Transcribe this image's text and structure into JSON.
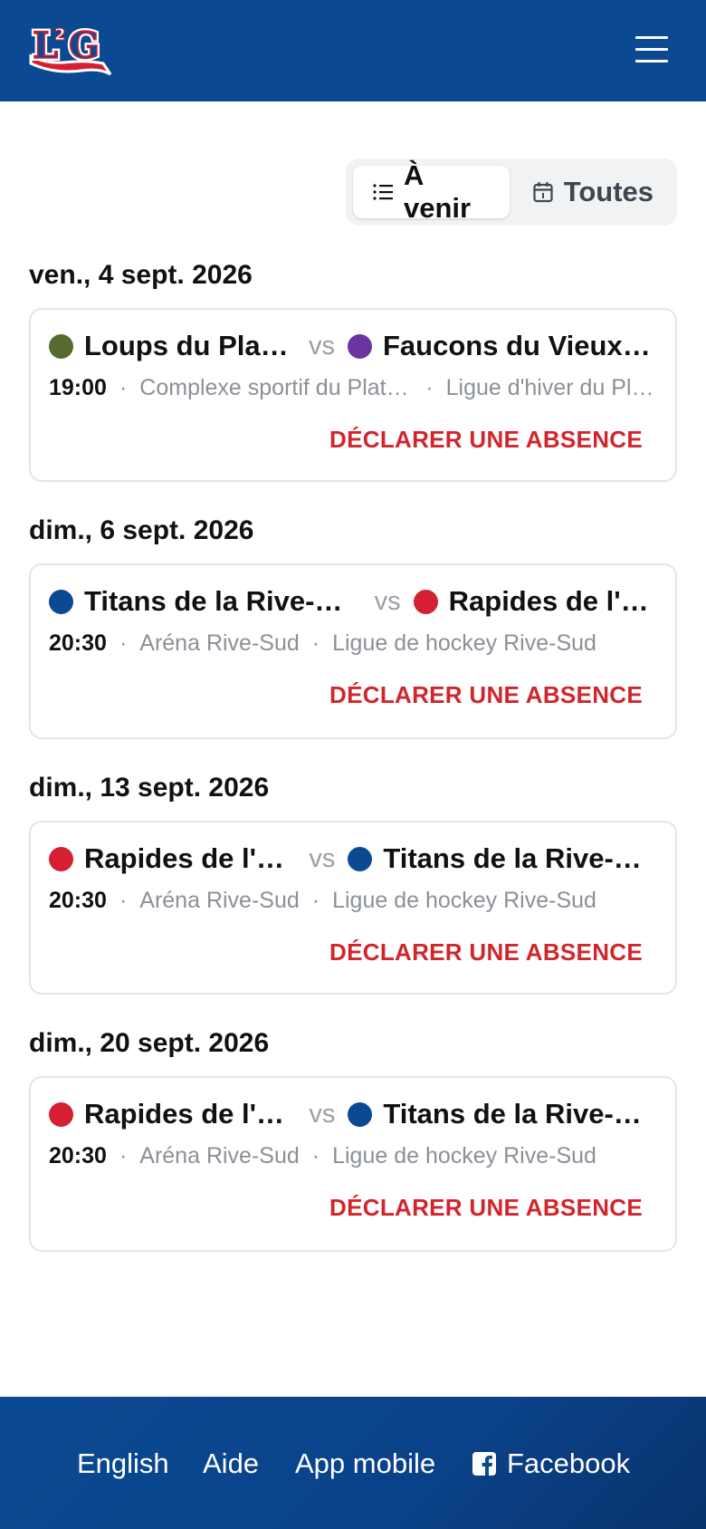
{
  "header": {
    "logo_text": "L2G"
  },
  "filter": {
    "upcoming_label": "À venir",
    "all_label": "Toutes",
    "active": "upcoming"
  },
  "separator": "·",
  "vs_label": "vs",
  "games": [
    {
      "date": "ven., 4 sept. 2026",
      "home": {
        "name": "Loups du Plateau",
        "color": "#556b2f"
      },
      "away": {
        "name": "Faucons du Vieux-Port",
        "color": "#6a35a0"
      },
      "time": "19:00",
      "venue": "Complexe sportif du Plateau",
      "league": "Ligue d'hiver du Plateau",
      "action": "DÉCLARER UNE ABSENCE"
    },
    {
      "date": "dim., 6 sept. 2026",
      "home": {
        "name": "Titans de la Rive-Sud",
        "color": "#0b4a93"
      },
      "away": {
        "name": "Rapides de l'Est",
        "color": "#d71f33"
      },
      "time": "20:30",
      "venue": "Aréna Rive-Sud",
      "league": "Ligue de hockey Rive-Sud",
      "action": "DÉCLARER UNE ABSENCE"
    },
    {
      "date": "dim., 13 sept. 2026",
      "home": {
        "name": "Rapides de l'Est",
        "color": "#d71f33"
      },
      "away": {
        "name": "Titans de la Rive-Sud",
        "color": "#0b4a93"
      },
      "time": "20:30",
      "venue": "Aréna Rive-Sud",
      "league": "Ligue de hockey Rive-Sud",
      "action": "DÉCLARER UNE ABSENCE"
    },
    {
      "date": "dim., 20 sept. 2026",
      "home": {
        "name": "Rapides de l'Est",
        "color": "#d71f33"
      },
      "away": {
        "name": "Titans de la Rive-Sud",
        "color": "#0b4a93"
      },
      "time": "20:30",
      "venue": "Aréna Rive-Sud",
      "league": "Ligue de hockey Rive-Sud",
      "action": "DÉCLARER UNE ABSENCE"
    }
  ],
  "footer": {
    "links": [
      "English",
      "Aide",
      "App mobile",
      "Facebook"
    ]
  },
  "colors": {
    "brand": "#0b4a93",
    "danger": "#d0262c",
    "muted": "#8b9098"
  },
  "icons": {
    "menu": "hamburger-icon",
    "upcoming": "list-icon",
    "all": "calendar-icon",
    "facebook": "facebook-icon"
  }
}
